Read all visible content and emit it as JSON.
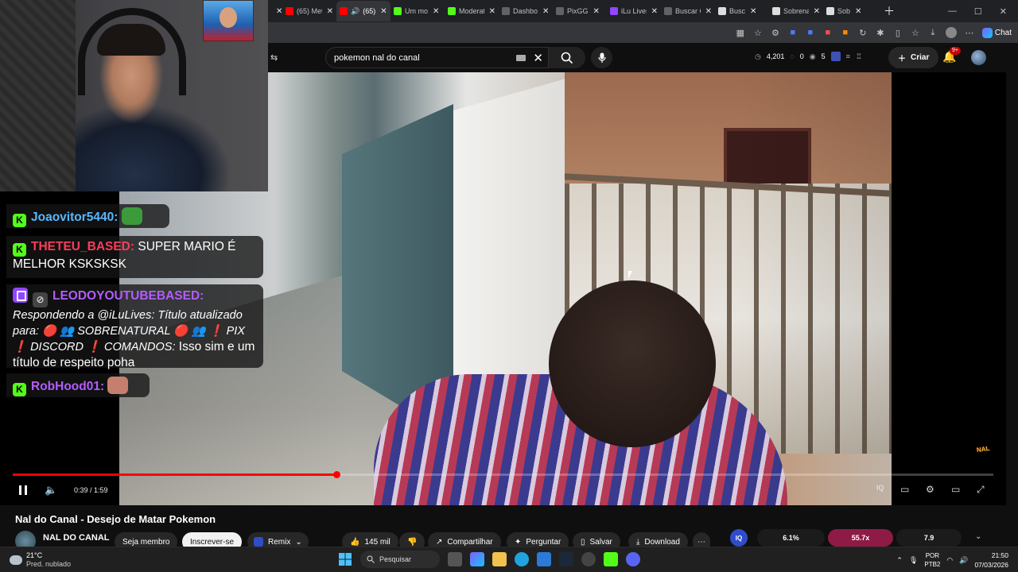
{
  "browser": {
    "tabs": [
      {
        "label": "",
        "color": "#888888",
        "active": false
      },
      {
        "label": "(65) Met",
        "color": "#ff0000",
        "active": false
      },
      {
        "label": "(65)",
        "color": "#ff0000",
        "active": true,
        "audio": true
      },
      {
        "label": "Um mo",
        "color": "#53fc18",
        "active": false
      },
      {
        "label": "Moderat",
        "color": "#53fc18",
        "active": false
      },
      {
        "label": "Dashbo",
        "color": "#5f6368",
        "active": false
      },
      {
        "label": "PixGG",
        "color": "#5f6368",
        "active": false
      },
      {
        "label": "iLu Lives",
        "color": "#9146ff",
        "active": false
      },
      {
        "label": "Buscar C",
        "color": "#5f6368",
        "active": false
      },
      {
        "label": "Busc",
        "color": "#dddddd",
        "active": false
      },
      {
        "label": "Sobrena",
        "color": "#dddddd",
        "active": false
      },
      {
        "label": "Sob",
        "color": "#dddddd",
        "active": false
      }
    ],
    "chat_label": "Chat"
  },
  "youtube": {
    "search_query": "pokemon nal do canal",
    "ext_stats": {
      "views": "4,201",
      "likes": "0",
      "watching": "5"
    },
    "create_label": "Criar",
    "notif_badge": "9+"
  },
  "video": {
    "time": "0:39 / 1:59",
    "progress": 0.33,
    "watermark": "NAL"
  },
  "chat": {
    "messages": [
      {
        "user": "Joaovitor5440:",
        "text": "",
        "platform": "kick"
      },
      {
        "user": "THETEU_BASED:",
        "text": "SUPER MARIO É MELHOR KSKSKSK",
        "platform": "kick"
      },
      {
        "user": "LEODOYOUTUBEBASED:",
        "reply": "Respondendo a @iLuLives: Título atualizado para: 🔴 👥 SOBRENATURAL 🔴 👥 ❗ PIX ❗ DISCORD ❗ COMANDOS:",
        "text": "Isso sim e um título de respeito poha",
        "platform": "twitch"
      },
      {
        "user": "RobHood01:",
        "text": "",
        "platform": "kick"
      }
    ]
  },
  "below": {
    "title": "Nal do Canal - Desejo de Matar Pokemon",
    "channel": "NAL DO CANAL",
    "join": "Seja membro",
    "subscribe": "Inscrever-se",
    "remix": "Remix",
    "likes": "145 mil",
    "share": "Compartilhar",
    "ask": "Perguntar",
    "save": "Salvar",
    "download": "Download",
    "iq": "IQ",
    "stat1": "6.1%",
    "stat2": "55.7x",
    "stat3": "7.9"
  },
  "taskbar": {
    "temp": "21°C",
    "weather": "Pred. nublado",
    "search": "Pesquisar",
    "lang1": "POR",
    "lang2": "PTB2",
    "time": "21:50",
    "date": "07/03/2026"
  }
}
